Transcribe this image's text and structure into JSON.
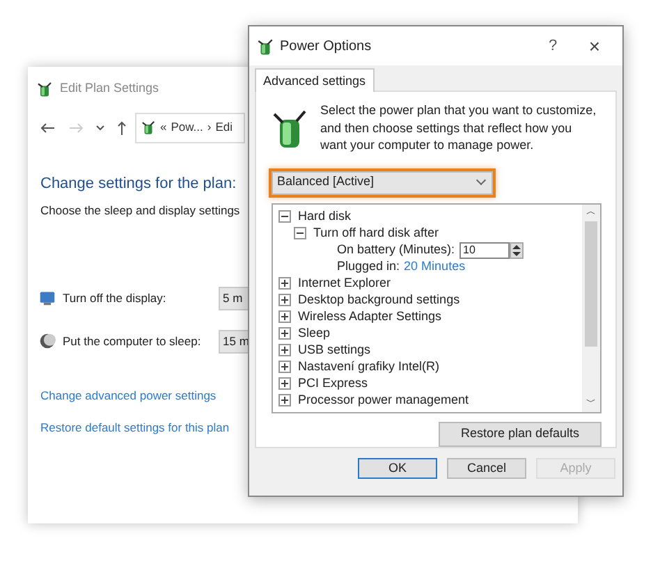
{
  "back_window": {
    "title": "Edit Plan Settings",
    "breadcrumb": [
      "«",
      "Pow...",
      "›",
      "Edi"
    ],
    "heading": "Change settings for the plan:",
    "subtitle": "Choose the sleep and display settings",
    "settings": [
      {
        "kind": "display",
        "label": "Turn off the display:",
        "value": "5 m"
      },
      {
        "kind": "sleep",
        "label": "Put the computer to sleep:",
        "value": "15 m"
      }
    ],
    "links": [
      "Change advanced power settings",
      "Restore default settings for this plan"
    ]
  },
  "dialog": {
    "title": "Power Options",
    "help": "?",
    "close": "×",
    "tab": {
      "label": "Advanced settings",
      "selected": true
    },
    "description": "Select the power plan that you want to customize, and then choose settings that reflect how you want your computer to manage power.",
    "plan": "Balanced [Active]",
    "tree": [
      {
        "label": "Hard disk",
        "expanded": true,
        "children": [
          {
            "label": "Turn off hard disk after",
            "expanded": true,
            "children": [
              {
                "kind": "spin",
                "label": "On battery (Minutes):",
                "value": "10"
              },
              {
                "kind": "link",
                "label": "Plugged in:",
                "value": "20 Minutes"
              }
            ]
          }
        ]
      },
      {
        "label": "Internet Explorer",
        "expanded": false
      },
      {
        "label": "Desktop background settings",
        "expanded": false
      },
      {
        "label": "Wireless Adapter Settings",
        "expanded": false
      },
      {
        "label": "Sleep",
        "expanded": false
      },
      {
        "label": "USB settings",
        "expanded": false
      },
      {
        "label": "Nastavení grafiky Intel(R)",
        "expanded": false
      },
      {
        "label": "PCI Express",
        "expanded": false
      },
      {
        "label": "Processor power management",
        "expanded": false
      }
    ],
    "scroll_up": "︿",
    "scroll_down": "﹀",
    "restore": "Restore plan defaults",
    "buttons": [
      {
        "label": "OK",
        "disabled": false,
        "default": true
      },
      {
        "label": "Cancel",
        "disabled": false,
        "default": false
      },
      {
        "label": "Apply",
        "disabled": true,
        "default": false
      }
    ]
  }
}
